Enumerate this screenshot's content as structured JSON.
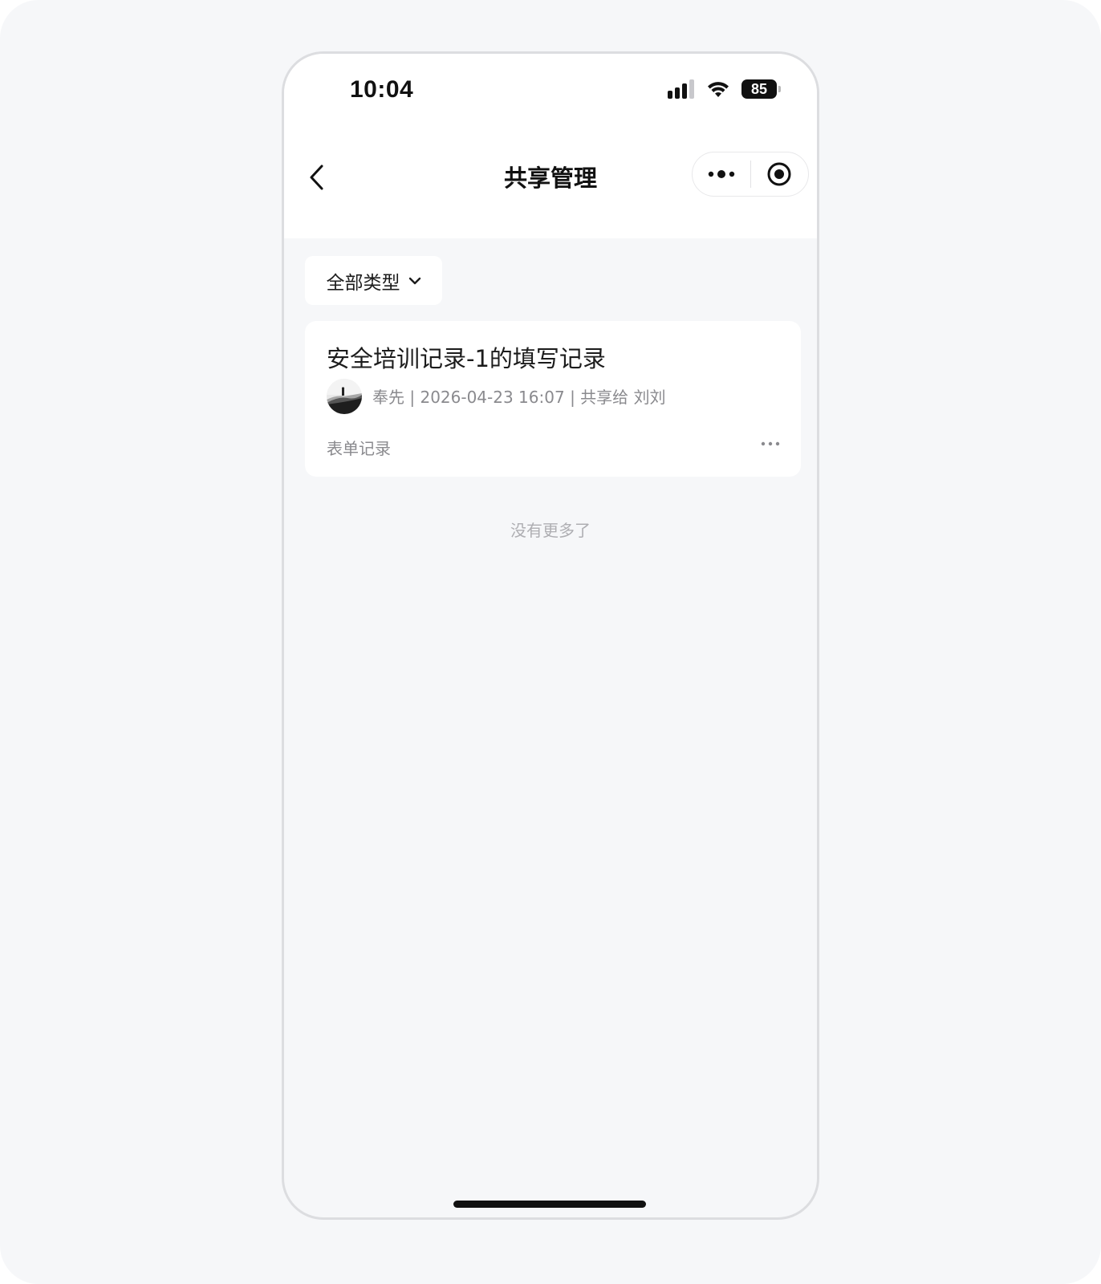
{
  "status_bar": {
    "time": "10:04",
    "battery": "85",
    "icons": [
      "signal-icon",
      "wifi-icon",
      "battery-icon"
    ]
  },
  "nav": {
    "title": "共享管理",
    "back_icon": "chevron-left-icon",
    "more_icon": "more-dots-icon",
    "close_icon": "target-close-icon"
  },
  "filter": {
    "label": "全部类型",
    "icon": "chevron-down-icon"
  },
  "records": [
    {
      "title": "安全培训记录-1的填写记录",
      "author": "奉先",
      "date": "2026-04-23 16:07",
      "shared_to_prefix": "共享给",
      "shared_to": "刘刘",
      "type": "表单记录",
      "more_icon": "ellipsis-icon"
    }
  ],
  "list_footer": "没有更多了",
  "colors": {
    "background": "#f6f7f9",
    "card": "#ffffff",
    "text_primary": "#1c1c1c",
    "text_secondary": "#8a8a8e",
    "text_hint": "#aeaeb2"
  }
}
